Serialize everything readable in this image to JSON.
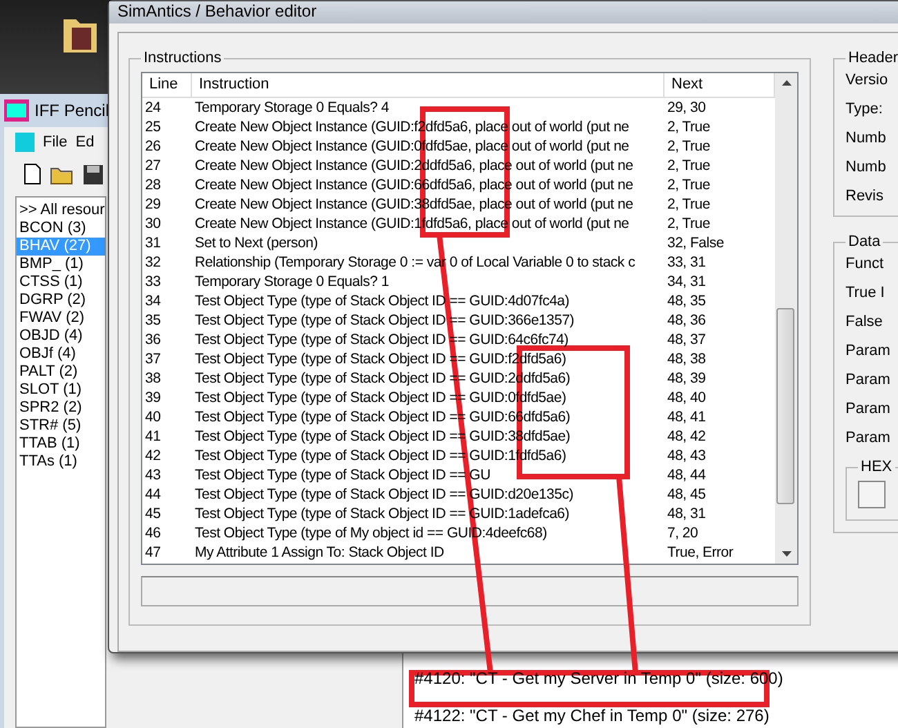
{
  "iff_window": {
    "title": "IFF Pencil",
    "menu": [
      "File",
      "Ed"
    ],
    "resources": [
      {
        "label": ">> All resour",
        "selected": false
      },
      {
        "label": "BCON (3)",
        "selected": false
      },
      {
        "label": "BHAV (27)",
        "selected": true
      },
      {
        "label": "BMP_ (1)",
        "selected": false
      },
      {
        "label": "CTSS (1)",
        "selected": false
      },
      {
        "label": "DGRP (2)",
        "selected": false
      },
      {
        "label": "FWAV (2)",
        "selected": false
      },
      {
        "label": "OBJD (4)",
        "selected": false
      },
      {
        "label": "OBJf (4)",
        "selected": false
      },
      {
        "label": "PALT (2)",
        "selected": false
      },
      {
        "label": "SLOT (1)",
        "selected": false
      },
      {
        "label": "SPR2 (2)",
        "selected": false
      },
      {
        "label": "STR# (5)",
        "selected": false
      },
      {
        "label": "TTAB (1)",
        "selected": false
      },
      {
        "label": "TTAs (1)",
        "selected": false
      }
    ],
    "strings": [
      "#4120: \"CT - Get my Server in Temp 0\" (size: 600)",
      "#4122: \"CT - Get my Chef in Temp 0\" (size: 276)"
    ]
  },
  "dialog": {
    "title": "SimAntics / Behavior editor",
    "instructions_title": "Instructions",
    "columns": [
      "Line",
      "Instruction",
      "Next"
    ],
    "rows": [
      {
        "line": "24",
        "instruction": "Temporary Storage 0 Equals? 4",
        "next": "29, 30"
      },
      {
        "line": "25",
        "instruction": "Create New Object Instance (GUID:f2dfd5a6, place out of world (put ne",
        "next": "2, True"
      },
      {
        "line": "26",
        "instruction": "Create New Object Instance (GUID:0fdfd5ae, place out of world (put ne",
        "next": "2, True"
      },
      {
        "line": "27",
        "instruction": "Create New Object Instance (GUID:2ddfd5a6, place out of world (put ne",
        "next": "2, True"
      },
      {
        "line": "28",
        "instruction": "Create New Object Instance (GUID:66dfd5a6, place out of world (put ne",
        "next": "2, True"
      },
      {
        "line": "29",
        "instruction": "Create New Object Instance (GUID:38dfd5ae, place out of world (put ne",
        "next": "2, True"
      },
      {
        "line": "30",
        "instruction": "Create New Object Instance (GUID:1fdfd5a6, place out of world (put ne",
        "next": "2, True"
      },
      {
        "line": "31",
        "instruction": "Set to Next (person)",
        "next": "32, False"
      },
      {
        "line": "32",
        "instruction": "Relationship (Temporary Storage 0 := var 0 of Local Variable 0 to stack c",
        "next": "33, 31"
      },
      {
        "line": "33",
        "instruction": "Temporary Storage 0 Equals? 1",
        "next": "34, 31"
      },
      {
        "line": "34",
        "instruction": "Test Object Type (type of Stack Object ID == GUID:4d07fc4a)",
        "next": "48, 35"
      },
      {
        "line": "35",
        "instruction": "Test Object Type (type of Stack Object ID == GUID:366e1357)",
        "next": "48, 36"
      },
      {
        "line": "36",
        "instruction": "Test Object Type (type of Stack Object ID == GUID:64c6fc74)",
        "next": "48, 37"
      },
      {
        "line": "37",
        "instruction": "Test Object Type (type of Stack Object ID == GUID:f2dfd5a6)",
        "next": "48, 38"
      },
      {
        "line": "38",
        "instruction": "Test Object Type (type of Stack Object ID == GUID:2ddfd5a6)",
        "next": "48, 39"
      },
      {
        "line": "39",
        "instruction": "Test Object Type (type of Stack Object ID == GUID:0fdfd5ae)",
        "next": "48, 40"
      },
      {
        "line": "40",
        "instruction": "Test Object Type (type of Stack Object ID == GUID:66dfd5a6)",
        "next": "48, 41"
      },
      {
        "line": "41",
        "instruction": "Test Object Type (type of Stack Object ID == GUID:38dfd5ae)",
        "next": "48, 42"
      },
      {
        "line": "42",
        "instruction": "Test Object Type (type of Stack Object ID == GUID:1fdfd5a6)",
        "next": "48, 43"
      },
      {
        "line": "43",
        "instruction": "Test Object Type (type of Stack Object ID == GU",
        "next": "48, 44"
      },
      {
        "line": "44",
        "instruction": "Test Object Type (type of Stack Object ID == GUID:d20e135c)",
        "next": "48, 45"
      },
      {
        "line": "45",
        "instruction": "Test Object Type (type of Stack Object ID == GUID:1adefca6)",
        "next": "48, 31"
      },
      {
        "line": "46",
        "instruction": "Test Object Type (type of My object id == GUID:4deefc68)",
        "next": "7, 20"
      },
      {
        "line": "47",
        "instruction": "My Attribute 1 Assign To: Stack Object ID",
        "next": "True, Error"
      }
    ],
    "header_title": "Header",
    "header_labels": [
      "Versio",
      "Type:",
      "Numb",
      "Numb",
      "Revis"
    ],
    "data_title": "Data",
    "data_labels": [
      "Funct",
      "True I",
      "False",
      "Param",
      "Param",
      "Param",
      "Param"
    ],
    "hex_title": "HEX"
  }
}
